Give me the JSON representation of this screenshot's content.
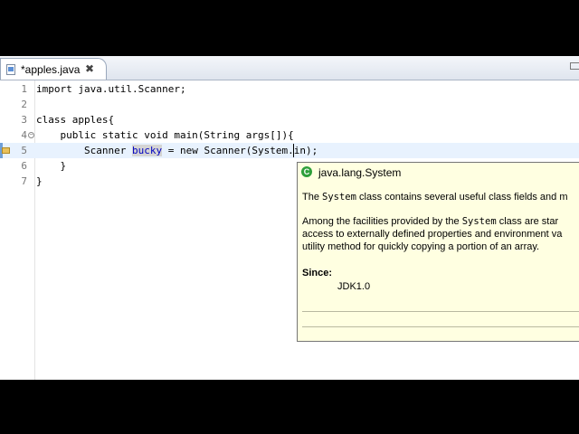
{
  "editor": {
    "tab": {
      "title": "*apples.java",
      "close_glyph": "✖"
    },
    "fold_glyph": "−",
    "lines": [
      {
        "number": "1",
        "text": "import java.util.Scanner;"
      },
      {
        "number": "2",
        "text": ""
      },
      {
        "number": "3",
        "text": "class apples{"
      },
      {
        "number": "4",
        "text": "    public static void main(String args[]){"
      },
      {
        "number": "5",
        "pre": "        Scanner ",
        "highlight": "bucky",
        "post": " = new Scanner(System.in);"
      },
      {
        "number": "6",
        "text": "    }"
      },
      {
        "number": "7",
        "text": "}"
      }
    ]
  },
  "javadoc": {
    "icon_letter": "C",
    "title": "java.lang.System",
    "p1_a": "The ",
    "p1_code": "System",
    "p1_b": " class contains several useful class fields and m",
    "p2_a": "Among the facilities provided by the ",
    "p2_code": "System",
    "p2_b": " class are star",
    "p2_line2": "access to externally defined properties and environment va",
    "p2_line3": "utility method for quickly copying a portion of an array.",
    "since_label": "Since:",
    "since_value": "JDK1.0"
  },
  "colors": {
    "current_line": "#e8f2fe",
    "tooltip_bg": "#ffffe1",
    "selection_bg": "#d4d4d4"
  }
}
